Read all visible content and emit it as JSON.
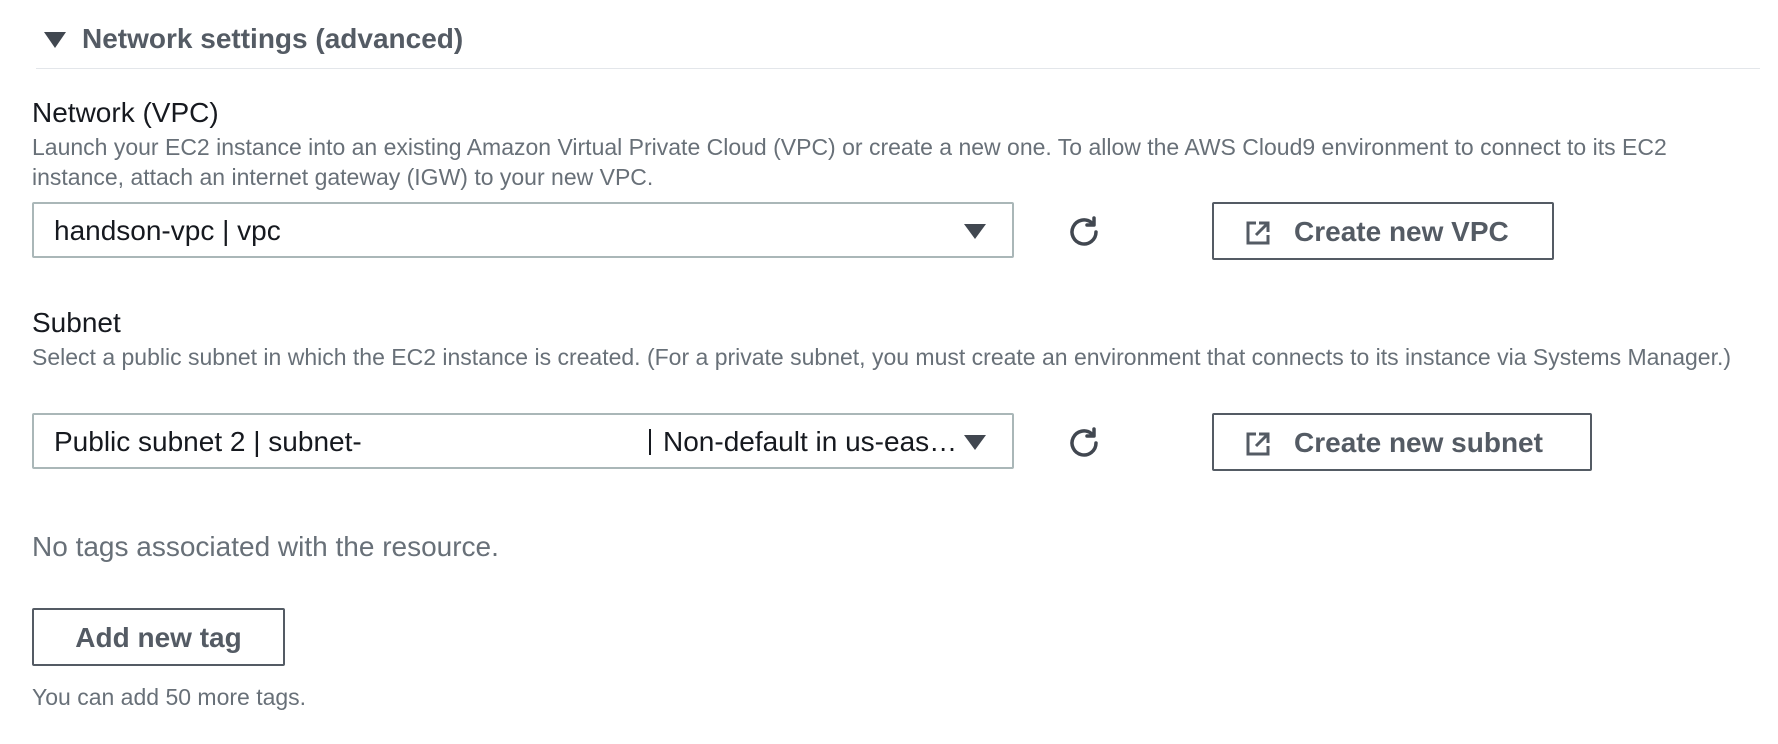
{
  "section": {
    "title": "Network settings (advanced)",
    "expanded": true
  },
  "vpc": {
    "label": "Network (VPC)",
    "description": "Launch your EC2 instance into an existing Amazon Virtual Private Cloud (VPC) or create a new one. To allow the AWS Cloud9 environment to connect to its EC2 instance, attach an internet gateway (IGW) to your new VPC.",
    "selected": "handson-vpc | vpc",
    "create_button": "Create new VPC",
    "refresh_icon": "refresh-icon",
    "external_icon": "external-link-icon"
  },
  "subnet": {
    "label": "Subnet",
    "description": "Select a public subnet in which the EC2 instance is created. (For a private subnet, you must create an environment that connects to its instance via Systems Manager.)",
    "selected": "Public subnet 2 | subnet-",
    "selected_detail": "Non-default in us-eas…",
    "create_button": "Create new subnet",
    "refresh_icon": "refresh-icon",
    "external_icon": "external-link-icon"
  },
  "tags": {
    "empty_text": "No tags associated with the resource.",
    "add_button": "Add new tag",
    "hint": "You can add 50 more tags."
  },
  "colors": {
    "text": "#16191f",
    "secondary_text": "#687078",
    "button_border": "#545b64",
    "input_border": "#aab7b8",
    "divider": "#e3e6ea"
  }
}
